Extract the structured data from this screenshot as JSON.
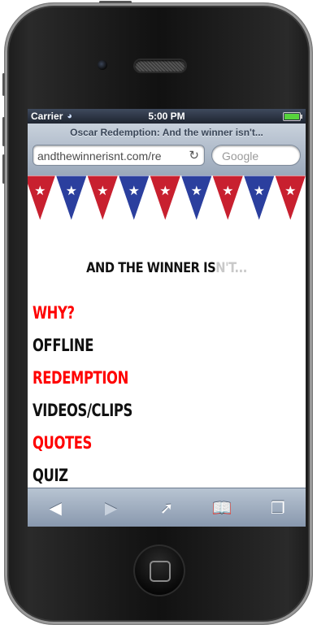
{
  "statusbar": {
    "carrier": "Carrier",
    "time": "5:00 PM"
  },
  "browser": {
    "page_title": "Oscar Redemption: And the winner isn't...",
    "url": "andthewinnerisnt.com/re",
    "search_placeholder": "Google"
  },
  "site": {
    "headline_dark": "AND THE WINNER IS",
    "headline_light": "N'T...",
    "menu": [
      {
        "label": "WHY?",
        "color": "#ff0000"
      },
      {
        "label": "OFFLINE",
        "color": "#111111"
      },
      {
        "label": "REDEMPTION",
        "color": "#ff0000"
      },
      {
        "label": "VIDEOS/CLIPS",
        "color": "#111111"
      },
      {
        "label": "QUOTES",
        "color": "#ff0000"
      },
      {
        "label": "QUIZ",
        "color": "#111111"
      }
    ],
    "bunting_colors": [
      "#c8202f",
      "#2b3f9e"
    ]
  },
  "toolbar": {
    "back": "back-icon",
    "forward": "forward-icon",
    "share": "share-icon",
    "bookmarks": "bookmarks-icon",
    "tabs": "tabs-icon"
  }
}
